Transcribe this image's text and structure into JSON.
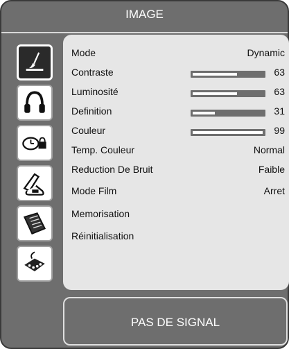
{
  "window": {
    "title": "IMAGE"
  },
  "sidebar": {
    "items": [
      {
        "icon": "picture-brush-icon",
        "active": true
      },
      {
        "icon": "headphones-icon",
        "active": false
      },
      {
        "icon": "clock-lock-icon",
        "active": false
      },
      {
        "icon": "setup-tool-icon",
        "active": false
      },
      {
        "icon": "document-list-icon",
        "active": false
      },
      {
        "icon": "connector-plug-icon",
        "active": false
      }
    ]
  },
  "menu": {
    "rows": [
      {
        "label": "Mode",
        "value": "Dynamic",
        "type": "text"
      },
      {
        "label": "Contraste",
        "value": "63",
        "type": "slider",
        "level": 0.63
      },
      {
        "label": "Luminosité",
        "value": "63",
        "type": "slider",
        "level": 0.63
      },
      {
        "label": "Definition",
        "value": "31",
        "type": "slider",
        "level": 0.31
      },
      {
        "label": "Couleur",
        "value": "99",
        "type": "slider",
        "level": 0.99
      },
      {
        "label": "Temp. Couleur",
        "value": "Normal",
        "type": "text"
      },
      {
        "label": "Reduction De Bruit",
        "value": "Faible",
        "type": "text"
      },
      {
        "label": "Mode Film",
        "value": "Arret",
        "type": "text"
      },
      {
        "label": "Memorisation",
        "value": "",
        "type": "action"
      },
      {
        "label": "Réinitialisation",
        "value": "",
        "type": "action"
      }
    ]
  },
  "status": {
    "text": "PAS DE SIGNAL"
  },
  "colors": {
    "frame": "#6e6e6e",
    "panel": "#e6e6e6",
    "slider_track": "#6e6e6e",
    "slider_fill": "#ffffff",
    "active_icon_bg": "#2a2a2a"
  }
}
